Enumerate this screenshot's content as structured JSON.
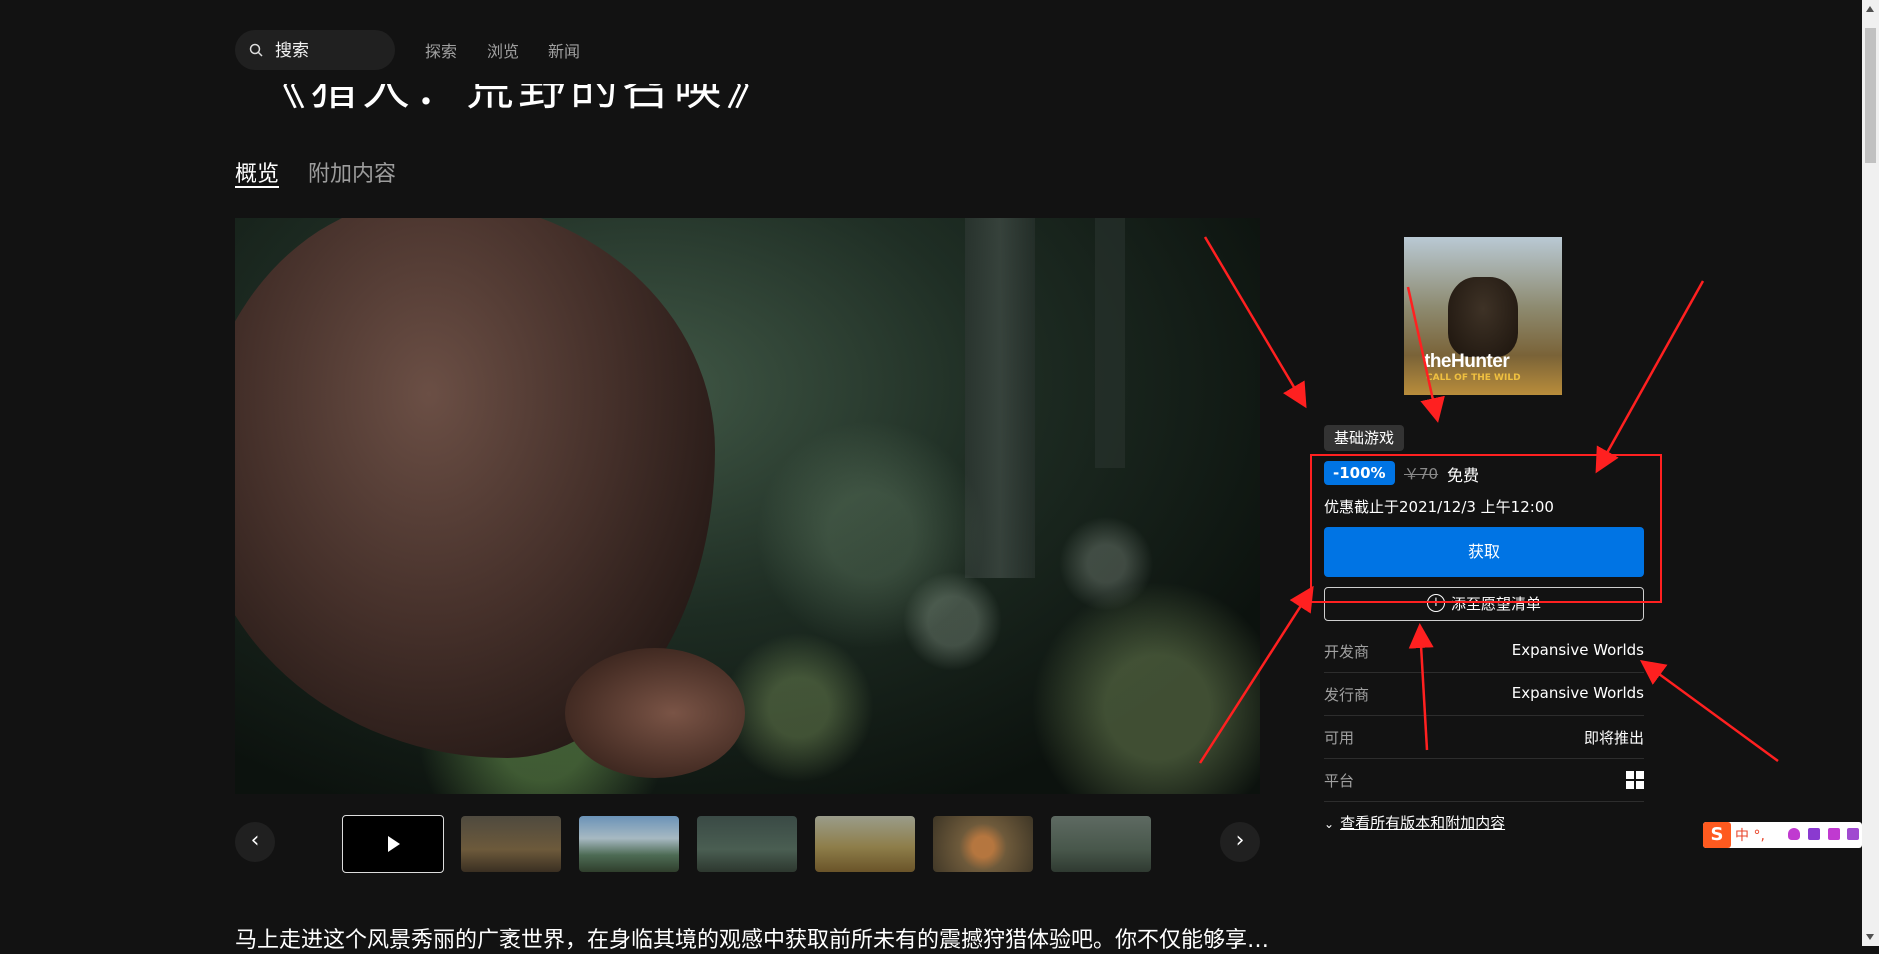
{
  "nav": {
    "search_placeholder": "搜索",
    "links": [
      "探索",
      "浏览",
      "新闻"
    ]
  },
  "game": {
    "title": "《猎人：荒野的召唤》"
  },
  "tabs": [
    {
      "label": "概览",
      "active": true
    },
    {
      "label": "附加内容",
      "active": false
    }
  ],
  "carousel": {
    "prev_label": "‹",
    "next_label": "›",
    "thumbnails": 7
  },
  "description": "马上走进这个风景秀丽的广袤世界，在身临其境的观感中获取前所未有的震撼狩猎体验吧。你不仅能够享…",
  "sidebar": {
    "cover_title": "theHunter",
    "cover_subtitle": "CALL OF THE WILD",
    "base_badge": "基础游戏",
    "discount": "-100%",
    "original_price": "￥70",
    "final_price": "免费",
    "offer_ends": "优惠截止于2021/12/3 上午12:00",
    "get_label": "获取",
    "wishlist_label": "添至愿望清单",
    "info": [
      {
        "key": "开发商",
        "value": "Expansive Worlds"
      },
      {
        "key": "发行商",
        "value": "Expansive Worlds"
      },
      {
        "key": "可用",
        "value": "即将推出"
      },
      {
        "key": "平台",
        "value": ""
      }
    ],
    "editions_link": "查看所有版本和附加内容"
  },
  "colors": {
    "accent": "#0074e4",
    "background": "#121212",
    "annotation": "#ff2020"
  },
  "ime": {
    "logo": "S",
    "mode": "中 °,"
  }
}
